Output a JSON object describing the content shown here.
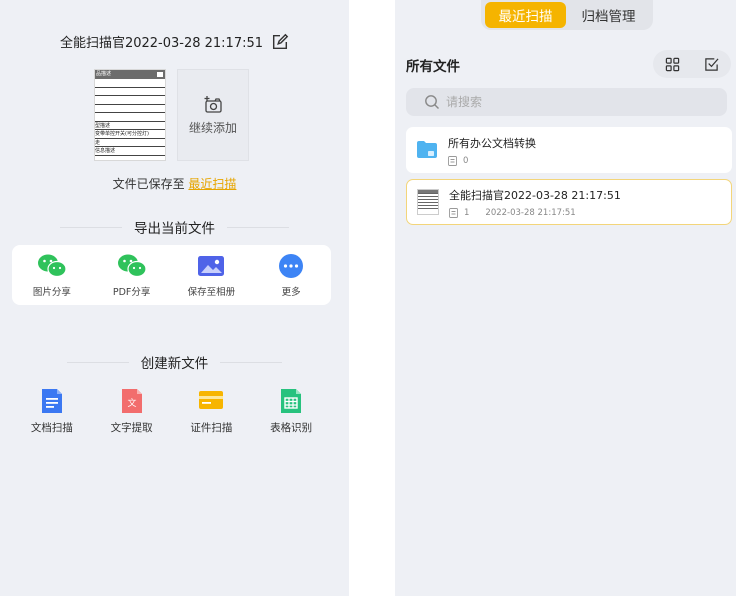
{
  "left": {
    "doc_title": "全能扫描官2022-03-28 21:17:51",
    "thumbnail": {
      "header": "品描述",
      "rows": [
        "",
        "",
        "",
        "",
        "",
        "型描述",
        "变带单控开关(可分控灯)",
        "走",
        "信息描述"
      ]
    },
    "continue_add_label": "继续添加",
    "saved_prefix": "文件已保存至 ",
    "saved_link": "最近扫描",
    "export_section_title": "导出当前文件",
    "export_items": [
      {
        "label": "图片分享",
        "icon": "wechat-icon"
      },
      {
        "label": "PDF分享",
        "icon": "wechat-icon"
      },
      {
        "label": "保存至相册",
        "icon": "photo-album-icon"
      },
      {
        "label": "更多",
        "icon": "more-icon"
      }
    ],
    "create_section_title": "创建新文件",
    "create_items": [
      {
        "label": "文档扫描",
        "icon": "document-scan-icon"
      },
      {
        "label": "文字提取",
        "icon": "text-extract-icon"
      },
      {
        "label": "证件扫描",
        "icon": "id-card-scan-icon"
      },
      {
        "label": "表格识别",
        "icon": "table-recognition-icon"
      }
    ]
  },
  "right": {
    "tabs": [
      {
        "label": "最近扫描",
        "active": true
      },
      {
        "label": "归档管理",
        "active": false
      }
    ],
    "all_files_title": "所有文件",
    "search_placeholder": "请搜索",
    "files": [
      {
        "name": "所有办公文档转换",
        "count": "0",
        "date": "",
        "icon": "folder-icon"
      },
      {
        "name": "全能扫描官2022-03-28 21:17:51",
        "count": "1",
        "date": "2022-03-28 21:17:51",
        "icon": "document-thumbnail"
      }
    ]
  },
  "colors": {
    "accent": "#f5b400",
    "link": "#e7a500",
    "wechat": "#2fc25b",
    "panel_bg": "#eef0f5"
  }
}
